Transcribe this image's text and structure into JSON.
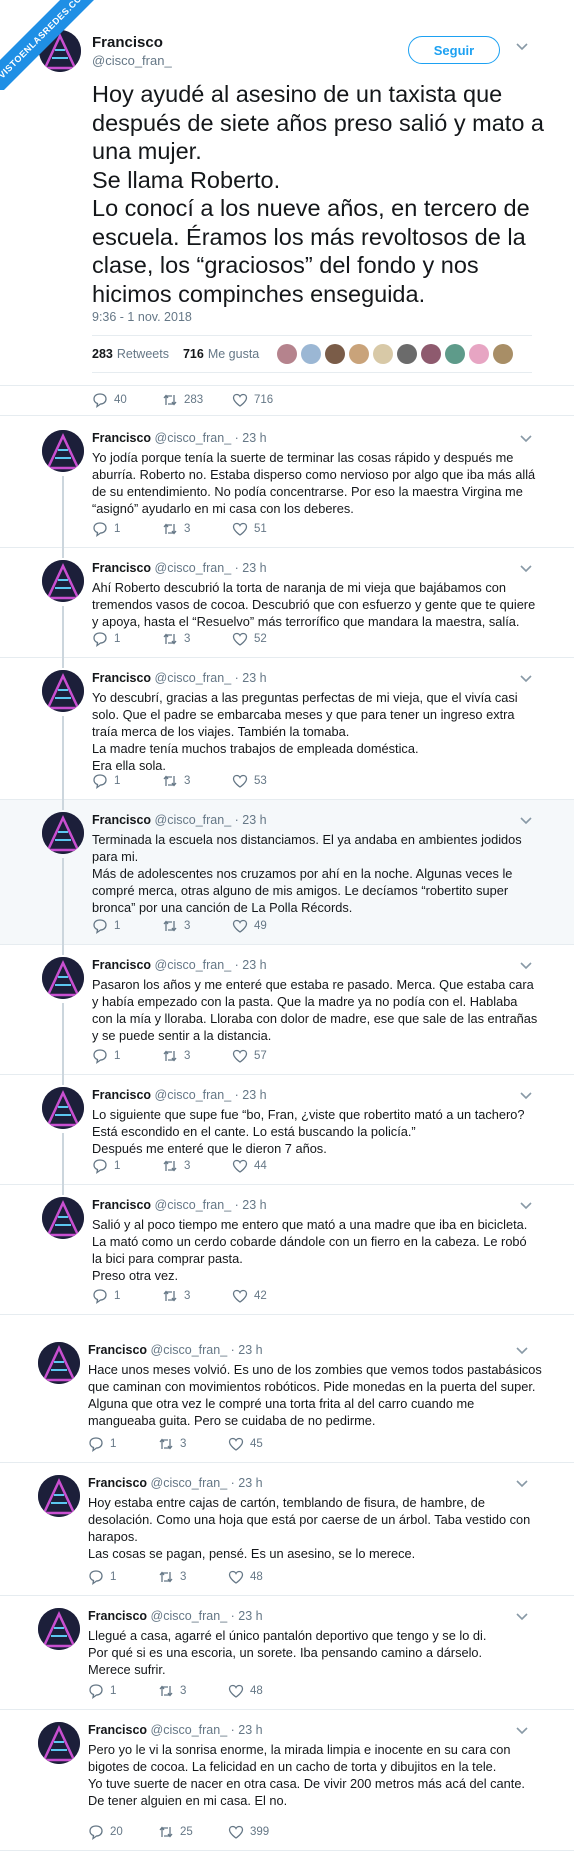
{
  "watermark": "VISTOENLASREDES.COM",
  "main_tweet": {
    "name": "Francisco",
    "handle": "@cisco_fran_",
    "follow_label": "Seguir",
    "text": "Hoy ayudé al asesino de un taxista que después de siete años preso salió y mato a una mujer.\nSe llama Roberto.\nLo conocí a los nueve años, en tercero de escuela. Éramos los más revoltosos de la clase, los “graciosos” del fondo y nos hicimos compinches enseguida.",
    "timestamp": "9:36 - 1 nov. 2018",
    "retweets_count": "283",
    "retweets_label": "Retweets",
    "likes_count": "716",
    "likes_label": "Me gusta",
    "liker_avatar_colors": [
      "#b5838d",
      "#9bb7d4",
      "#7a5c48",
      "#c9a37a",
      "#d8c9a7",
      "#6b6b6b",
      "#8e5a6e",
      "#5e9b8a",
      "#e7a5c3",
      "#a88e66"
    ],
    "reply_count": "40",
    "retweet_action_count": "283",
    "like_action_count": "716"
  },
  "replies": [
    {
      "name": "Francisco",
      "meta": "@cisco_fran_ · 23 h",
      "text": "Yo jodía porque tenía la suerte de terminar las cosas rápido y después me aburría. Roberto no. Estaba disperso como nervioso por algo que iba más allá de su entendimiento. No podía concentrarse. Por eso la maestra Virgina me “asignó” ayudarlo en mi casa con los deberes.",
      "replies": "1",
      "retweets": "3",
      "likes": "51"
    },
    {
      "name": "Francisco",
      "meta": "@cisco_fran_ · 23 h",
      "text": "Ahí Roberto descubrió la torta de naranja de mi vieja que bajábamos con tremendos vasos de cocoa. Descubrió que con esfuerzo y gente que te quiere y apoya, hasta el “Resuelvo” más terrorífico que mandara la maestra, salía.",
      "replies": "1",
      "retweets": "3",
      "likes": "52"
    },
    {
      "name": "Francisco",
      "meta": "@cisco_fran_ · 23 h",
      "text": "Yo descubrí, gracias a las preguntas perfectas de mi vieja, que el vivía casi solo. Que el padre se embarcaba meses y que para tener un ingreso extra traía merca de los viajes. También la tomaba.\nLa madre tenía muchos trabajos de empleada doméstica.\nEra ella sola.",
      "replies": "1",
      "retweets": "3",
      "likes": "53"
    },
    {
      "name": "Francisco",
      "meta": "@cisco_fran_ · 23 h",
      "text": "Terminada la escuela nos distanciamos. El ya andaba en ambientes jodidos para mi.\nMás de adolescentes nos cruzamos por ahí en la noche. Algunas veces le compré merca, otras alguno de mis amigos. Le decíamos “robertito super bronca” por una canción de La Polla Récords.",
      "replies": "1",
      "retweets": "3",
      "likes": "49"
    },
    {
      "name": "Francisco",
      "meta": "@cisco_fran_ · 23 h",
      "text": "Pasaron los años y me enteré que estaba re pasado. Merca. Que estaba cara y había empezado con la pasta. Que la madre ya no podía con el. Hablaba con la mía y lloraba. Lloraba con dolor de madre, ese que sale de las entrañas y se puede sentir a la distancia.",
      "replies": "1",
      "retweets": "3",
      "likes": "57"
    },
    {
      "name": "Francisco",
      "meta": "@cisco_fran_ · 23 h",
      "text": "Lo siguiente que supe fue “bo, Fran, ¿viste que robertito mató a un tachero? Está escondido en el cante. Lo está buscando la policía.”\nDespués me enteré que le dieron 7 años.",
      "replies": "1",
      "retweets": "3",
      "likes": "44"
    },
    {
      "name": "Francisco",
      "meta": "@cisco_fran_ · 23 h",
      "text": "Salió y al poco tiempo me entero que mató a una madre que iba en bicicleta. La mató como un cerdo cobarde dándole con un fierro en la cabeza. Le robó la bici para comprar pasta.\nPreso otra vez.",
      "replies": "1",
      "retweets": "3",
      "likes": "42"
    },
    {
      "name": "Francisco",
      "meta": "@cisco_fran_ · 23 h",
      "text": "Hace unos meses volvió. Es uno de los zombies que vemos todos pastabásicos que caminan con movimientos robóticos. Pide monedas en la puerta del super. Alguna que otra vez le compré una torta frita al del carro cuando me mangueaba guita. Pero se cuidaba de no pedirme.",
      "replies": "1",
      "retweets": "3",
      "likes": "45"
    },
    {
      "name": "Francisco",
      "meta": "@cisco_fran_ · 23 h",
      "text": "Hoy estaba entre cajas de cartón, temblando de fisura, de hambre, de desolación. Como una hoja que está por caerse de un árbol. Taba vestido con harapos.\nLas cosas se pagan, pensé. Es un asesino, se lo merece.",
      "replies": "1",
      "retweets": "3",
      "likes": "48"
    },
    {
      "name": "Francisco",
      "meta": "@cisco_fran_ · 23 h",
      "text": "Llegué a casa, agarré el único pantalón deportivo que tengo y se lo di.\nPor qué si es una escoria, un sorete. Iba pensando camino a dárselo.\nMerece sufrir.",
      "replies": "1",
      "retweets": "3",
      "likes": "48"
    },
    {
      "name": "Francisco",
      "meta": "@cisco_fran_ · 23 h",
      "text": "Pero yo le vi la sonrisa enorme, la mirada limpia e inocente en su cara con bigotes de cocoa. La felicidad  en un cacho de torta y dibujitos en la tele.\nYo tuve suerte de nacer en otra casa. De vivir 200 metros más acá del cante.\nDe tener alguien en mi casa. El no.",
      "replies": "20",
      "retweets": "25",
      "likes": "399"
    }
  ]
}
